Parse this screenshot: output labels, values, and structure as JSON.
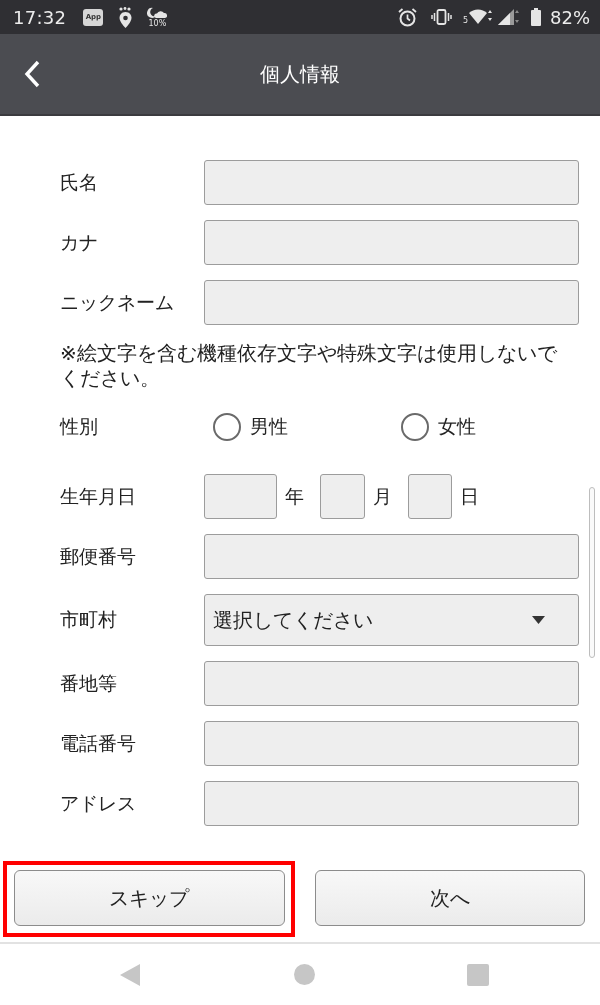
{
  "status_bar": {
    "time": "17:32",
    "app_badge": "App",
    "weather_text": "10%",
    "wifi_band": "5",
    "battery": "82%"
  },
  "header": {
    "title": "個人情報"
  },
  "rows": [
    {
      "kind": "text",
      "label": "氏名"
    },
    {
      "kind": "text",
      "label": "カナ"
    },
    {
      "kind": "text",
      "label": "ニックネーム"
    },
    {
      "kind": "note",
      "text": "※絵文字を含む機種依存文字や特殊文字は使用しないでください。"
    },
    {
      "kind": "radio",
      "label": "性別",
      "options": [
        {
          "label": "男性",
          "selected": false
        },
        {
          "label": "女性",
          "selected": false
        }
      ]
    },
    {
      "kind": "date",
      "label": "生年月日",
      "parts": [
        {
          "unit": "年"
        },
        {
          "unit": "月"
        },
        {
          "unit": "日"
        }
      ]
    },
    {
      "kind": "text",
      "label": "郵便番号"
    },
    {
      "kind": "select",
      "label": "市町村",
      "value": "選択してください"
    },
    {
      "kind": "text",
      "label": "番地等"
    },
    {
      "kind": "text",
      "label": "電話番号"
    },
    {
      "kind": "text",
      "label": "アドレス"
    }
  ],
  "buttons": [
    {
      "label": "スキップ",
      "highlighted": true
    },
    {
      "label": "次へ",
      "highlighted": false
    }
  ]
}
